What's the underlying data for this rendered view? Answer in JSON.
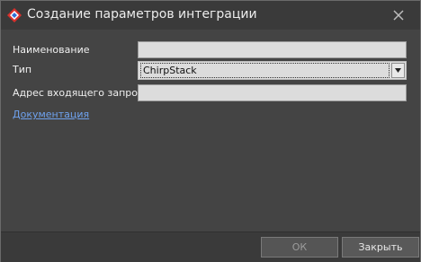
{
  "window": {
    "title": "Создание параметров интеграции"
  },
  "form": {
    "name_label": "Наименование",
    "name_value": "",
    "type_label": "Тип",
    "type_value": "ChirpStack",
    "address_label": "Адрес входящего запроса",
    "address_value": "",
    "doc_link": "Документация"
  },
  "buttons": {
    "ok_label": "ОК",
    "close_label": "Закрыть"
  },
  "icons": {
    "app": "diamond-logo-icon",
    "close": "close-icon",
    "dropdown": "chevron-down-icon"
  },
  "colors": {
    "background": "#444444",
    "link": "#6fa2ee",
    "logo_red": "#d9302c",
    "logo_blue": "#2f6fd6"
  }
}
